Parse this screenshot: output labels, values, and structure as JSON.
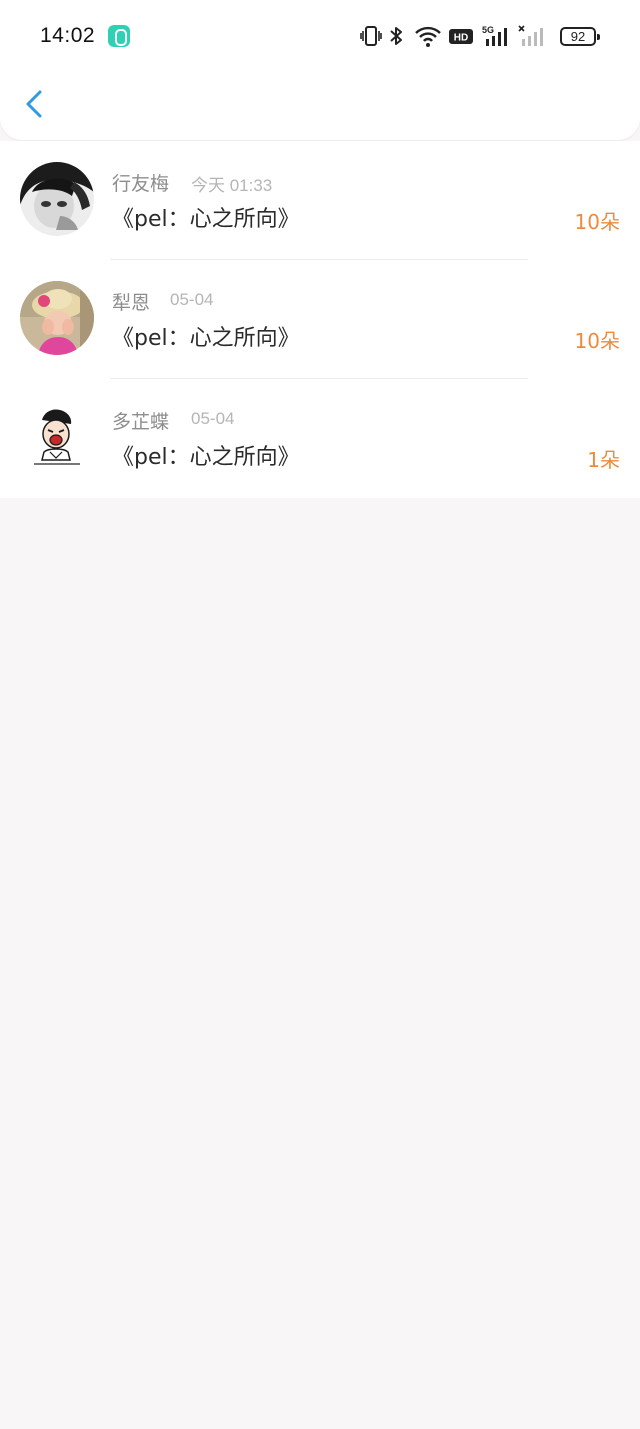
{
  "status_bar": {
    "time": "14:02",
    "battery": "92",
    "icons": [
      "app-badge-icon",
      "vibrate-icon",
      "bluetooth-icon",
      "wifi-icon",
      "hd-icon",
      "5g-signal-icon",
      "no-signal-icon",
      "battery-icon"
    ]
  },
  "header": {
    "back_icon": "chevron-left-icon",
    "accent_color": "#2f9ae0"
  },
  "records": [
    {
      "name": "行友梅",
      "date": "今天 01:33",
      "title": "《pel：心之所向》",
      "amount": "10朵"
    },
    {
      "name": "犁恩",
      "date": "05-04",
      "title": "《pel：心之所向》",
      "amount": "10朵"
    },
    {
      "name": "多芷蝶",
      "date": "05-04",
      "title": "《pel：心之所向》",
      "amount": "1朵"
    }
  ],
  "colors": {
    "amount": "#ee8a3d",
    "name": "#8d8d8d",
    "date": "#b5b5b5",
    "background": "#f8f6f6"
  }
}
